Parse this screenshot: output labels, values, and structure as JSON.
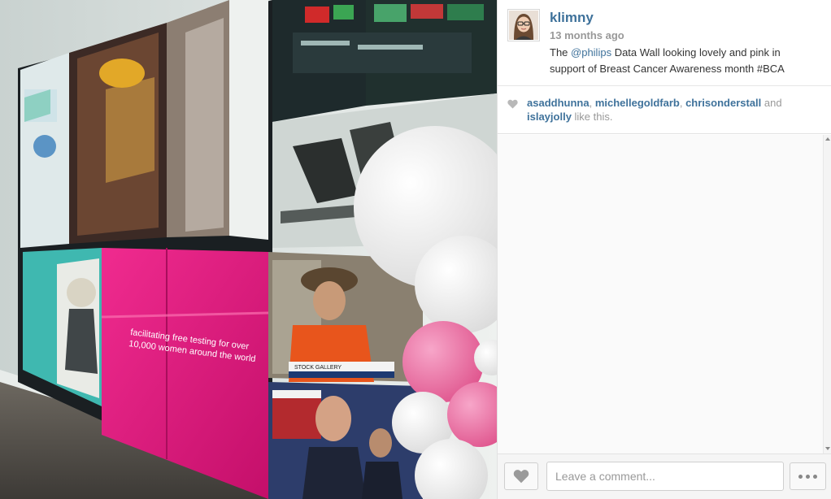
{
  "post": {
    "username": "klimny",
    "timestamp": "13 months ago",
    "caption": {
      "prefix": "The ",
      "mention": "@philips",
      "suffix": " Data Wall looking lovely and pink in support of Breast Cancer Awareness month #BCA"
    }
  },
  "photo": {
    "wall_text_line1": "facilitating free testing for over",
    "wall_text_line2": "10,000 women around the world",
    "tv_banner": "STOCK GALLERY"
  },
  "likes": {
    "users": [
      "asaddhunna",
      "michellegoldfarb",
      "chrisonderstall",
      "islayjolly"
    ],
    "sep1": ", ",
    "sep2": ", ",
    "sep3": " and",
    "suffix": " like this."
  },
  "footer": {
    "comment_placeholder": "Leave a comment...",
    "icons": {
      "like": "heart-icon",
      "more": "more-options-icon"
    }
  },
  "colors": {
    "link": "#3f729b",
    "muted": "#999999",
    "pink": "#e0157c"
  }
}
